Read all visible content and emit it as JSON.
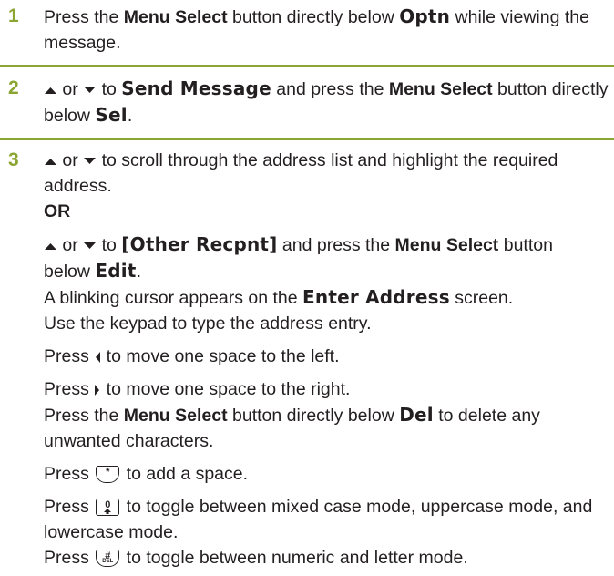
{
  "steps": [
    {
      "number": "1",
      "t1": "Press the ",
      "b1": "Menu Select",
      "t2": " button directly below ",
      "d1": "Optn",
      "t3": " while viewing the message."
    },
    {
      "number": "2",
      "t1": " or ",
      "t2": " to ",
      "d1": "Send Message",
      "t3": " and press the ",
      "b1": "Menu Select",
      "t4": " button directly below ",
      "d2": "Sel",
      "t5": "."
    },
    {
      "number": "3",
      "l1_t1": " or ",
      "l1_t2": " to scroll through the address list and highlight the required address.",
      "or_label": "OR",
      "l2_t1": " or ",
      "l2_t2": " to ",
      "l2_d1": "[Other Recpnt]",
      "l2_t3": " and press the ",
      "l2_b1": "Menu Select",
      "l2_t4": " button below ",
      "l2_d2": "Edit",
      "l2_t5": ".",
      "l3_t1": "A blinking cursor appears on the ",
      "l3_d1": "Enter Address",
      "l3_t2": " screen.",
      "l4": "Use the keypad to type the address entry.",
      "l5_t1": "Press ",
      "l5_t2": " to move one space to the left.",
      "l6_t1": "Press ",
      "l6_t2": " to move one space to the right.",
      "l7_t1": "Press the ",
      "l7_b1": "Menu Select",
      "l7_t2": " button directly below ",
      "l7_d1": "Del",
      "l7_t3": " to delete any unwanted characters.",
      "l8_t1": "Press ",
      "l8_t2": " to add a space.",
      "l9_t1": "Press ",
      "l9_t2": " to toggle between mixed case mode, uppercase mode, and lowercase mode.",
      "l10_t1": "Press ",
      "l10_t2": " to toggle between numeric and letter mode."
    }
  ],
  "icons": {
    "up": "up-arrow-icon",
    "down": "down-arrow-icon",
    "left": "left-nav-icon",
    "right": "right-nav-icon",
    "star_key": "star-key-icon",
    "zero_key": "zero-key-icon",
    "hash_key": "hash-key-icon"
  },
  "key_glyphs": {
    "star": "*",
    "zero": "0",
    "hash": "#",
    "hash_sub": "DEL"
  },
  "colors": {
    "accent": "#8aa531",
    "text": "#231f20"
  }
}
